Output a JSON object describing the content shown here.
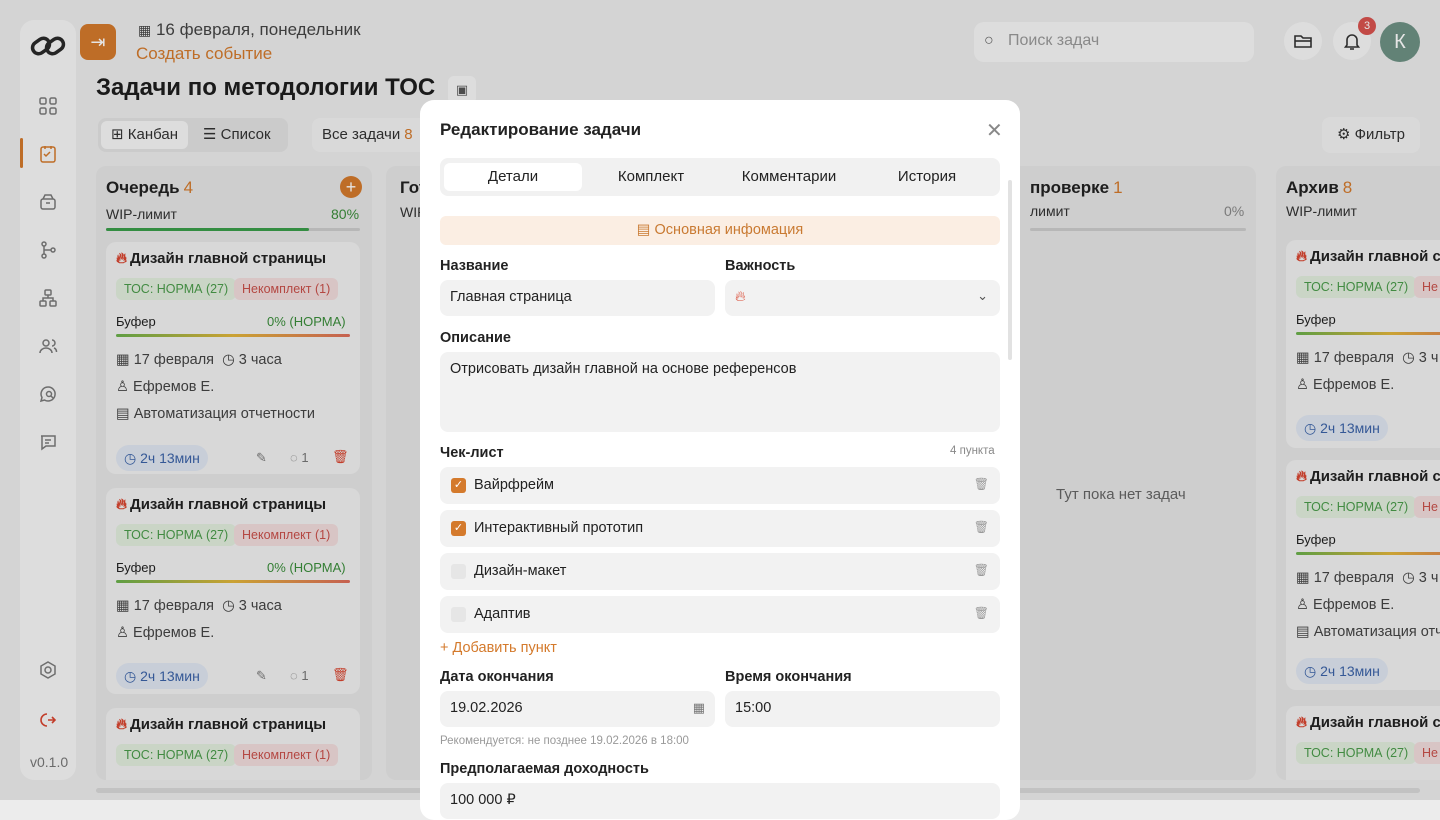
{
  "app": {
    "version": "v0.1.0"
  },
  "header": {
    "date": "16 февраля, понедельник",
    "create_event": "Создать событие",
    "search_placeholder": "Поиск задач",
    "notifications_count": "3",
    "avatar_initial": "К"
  },
  "page": {
    "title": "Задачи по методологии ТОС",
    "views": [
      "Канбан",
      "Список"
    ],
    "all_tasks_label": "Все задачи",
    "all_tasks_count": "8",
    "filter_label": "Фильтр"
  },
  "columns": [
    {
      "title": "Очередь",
      "count": "4",
      "wip_label": "WIP-лимит",
      "wip_pct": "80%",
      "wip_fraction": 0.8
    },
    {
      "title": "Гот",
      "wip_label": "WIP"
    },
    {
      "title": "проверке",
      "count": "1",
      "wip_label": "лимит",
      "wip_pct": "0%",
      "empty_text": "Тут пока нет задач"
    },
    {
      "title": "Архив",
      "count": "8",
      "wip_label": "WIP-лимит"
    }
  ],
  "cards": [
    {
      "title": "Дизайн главной страницы",
      "tag_green": "ТОС: НОРМА (27)",
      "tag_red": "Некомплект (1)",
      "buffer_label": "Буфер",
      "buffer_pct": "0% (НОРМА)",
      "date": "17 февраля",
      "duration": "3 часа",
      "assignee": "Ефремов Е.",
      "project": "Автоматизация отчетности",
      "time_spent": "2ч 13мин",
      "comments": "1"
    },
    {
      "title": "Дизайн главной страницы",
      "tag_green": "ТОС: НОРМА (27)",
      "tag_red": "Некомплект (1)",
      "buffer_label": "Буфер",
      "buffer_pct": "0% (НОРМА)",
      "date": "17 февраля",
      "duration": "3 часа",
      "assignee": "Ефремов Е.",
      "time_spent": "2ч 13мин",
      "comments": "1"
    },
    {
      "title": "Дизайн главной страницы",
      "tag_green": "ТОС: НОРМА (27)",
      "tag_red": "Некомплект (1)"
    }
  ],
  "archive_cards": [
    {
      "title": "Дизайн главной стр",
      "tag_green": "ТОС: НОРМА (27)",
      "tag_red": "Не",
      "buffer_label": "Буфер",
      "date": "17 февраля",
      "duration": "3 ч",
      "assignee": "Ефремов Е.",
      "time_spent": "2ч 13мин"
    },
    {
      "title": "Дизайн главной стр",
      "tag_green": "ТОС: НОРМА (27)",
      "tag_red": "Не",
      "buffer_label": "Буфер",
      "date": "17 февраля",
      "duration": "3 ч",
      "assignee": "Ефремов Е.",
      "project": "Автоматизация отч",
      "time_spent": "2ч 13мин"
    },
    {
      "title": "Дизайн главной стр",
      "tag_green": "ТОС: НОРМА (27)",
      "tag_red": "Не"
    }
  ],
  "modal": {
    "title": "Редактирование задачи",
    "tabs": [
      "Детали",
      "Комплект",
      "Комментарии",
      "История"
    ],
    "section": "Основная инфомация",
    "name_label": "Название",
    "name_value": "Главная страница",
    "importance_label": "Важность",
    "description_label": "Описание",
    "description_value": "Отрисовать дизайн главной на основе референсов",
    "checklist_label": "Чек-лист",
    "checklist_count": "4 пункта",
    "checklist": [
      {
        "text": "Вайрфрейм",
        "checked": true
      },
      {
        "text": "Интерактивный прототип",
        "checked": true
      },
      {
        "text": "Дизайн-макет",
        "checked": false
      },
      {
        "text": "Адаптив",
        "checked": false
      }
    ],
    "add_item": "Добавить пункт",
    "end_date_label": "Дата окончания",
    "end_date_value": "19.02.2026",
    "end_time_label": "Время окончания",
    "end_time_value": "15:00",
    "hint": "Рекомендуется: не позднее 19.02.2026 в 18:00",
    "revenue_label": "Предполагаемая доходность",
    "revenue_value": "100 000 ₽"
  },
  "colors": {
    "accent": "#d47a2c",
    "green": "#4a9b4a",
    "red": "#c9504a",
    "blue": "#3b63a8"
  }
}
